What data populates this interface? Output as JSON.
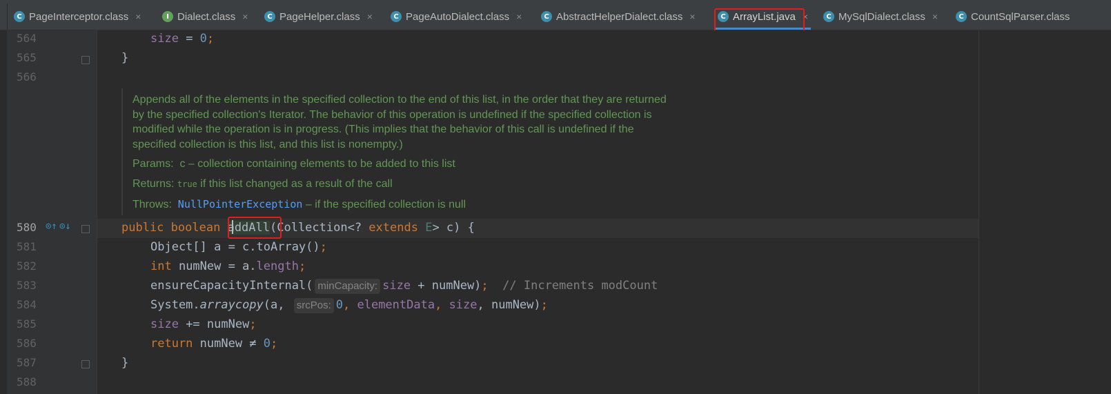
{
  "tabs": [
    {
      "label": "PageInterceptor.class",
      "icon": "C",
      "icon_name": "class-icon",
      "active": false
    },
    {
      "label": "Dialect.class",
      "icon": "I",
      "icon_name": "interface-icon",
      "active": false
    },
    {
      "label": "PageHelper.class",
      "icon": "C",
      "icon_name": "class-icon",
      "active": false
    },
    {
      "label": "PageAutoDialect.class",
      "icon": "C",
      "icon_name": "class-icon",
      "active": false
    },
    {
      "label": "AbstractHelperDialect.class",
      "icon": "C",
      "icon_name": "class-icon",
      "active": false
    },
    {
      "label": "ArrayList.java",
      "icon": "C",
      "icon_name": "class-icon",
      "active": true
    },
    {
      "label": "MySqlDialect.class",
      "icon": "C",
      "icon_name": "class-icon",
      "active": false
    },
    {
      "label": "CountSqlParser.class",
      "icon": "C",
      "icon_name": "class-icon",
      "active": false
    }
  ],
  "close_glyph": "×",
  "line_numbers": {
    "l564": "564",
    "l565": "565",
    "l566": "566",
    "l580": "580",
    "l581": "581",
    "l582": "582",
    "l583": "583",
    "l584": "584",
    "l585": "585",
    "l586": "586",
    "l587": "587",
    "l588": "588"
  },
  "doc": {
    "paragraph": "Appends all of the elements in the specified collection to the end of this list, in the order that they are returned by the specified collection's Iterator. The behavior of this operation is undefined if the specified collection is modified while the operation is in progress. (This implies that the behavior of this call is undefined if the specified collection is this list, and this list is nonempty.)",
    "params_label": "Params:",
    "params_text": "c – collection containing elements to be added to this list",
    "returns_label": "Returns:",
    "returns_code": "true",
    "returns_text": " if this list changed as a result of the call",
    "throws_label": "Throws:",
    "throws_link": "NullPointerException",
    "throws_text": " – if the specified collection is null"
  },
  "code": {
    "l564": {
      "field": "size",
      "op": " = ",
      "num": "0",
      "semi": ";"
    },
    "l565": {
      "brace": "}"
    },
    "l580": {
      "k1": "public",
      "k2": "boolean",
      "method": "addAll",
      "p1": "(Collection<? ",
      "k3": "extends",
      "tp": "E",
      "p2": "> c) {"
    },
    "l581": {
      "text": "Object[] a = c.toArray()",
      "semi": ";"
    },
    "l582": {
      "k": "int",
      "text": " numNew = a.",
      "field": "length",
      "semi": ";"
    },
    "l583": {
      "call": "ensureCapacityInternal(",
      "hint": "minCapacity:",
      "field": "size",
      "rest": " + numNew)",
      "semi": ";",
      "comment": "// Increments modCount"
    },
    "l584": {
      "cls": "System.",
      "call": "arraycopy",
      "a": "(a, ",
      "hint": "srcPos:",
      "num": "0",
      "c1": ", ",
      "f1": "elementData",
      "c2": ", ",
      "f2": "size",
      "rest": ", numNew)",
      "semi": ";"
    },
    "l585": {
      "field": "size",
      "rest": " += numNew",
      "semi": ";"
    },
    "l586": {
      "k": "return",
      "rest": " numNew ≠ ",
      "num": "0",
      "semi": ";"
    },
    "l587": {
      "brace": "}"
    }
  },
  "colors": {
    "background": "#2b2b2b",
    "keyword": "#cc7832",
    "number": "#6897bb",
    "field": "#9876aa",
    "doc_comment": "#629755",
    "highlight_box": "#e11d1d",
    "active_tab_underline": "#4a88c7"
  }
}
